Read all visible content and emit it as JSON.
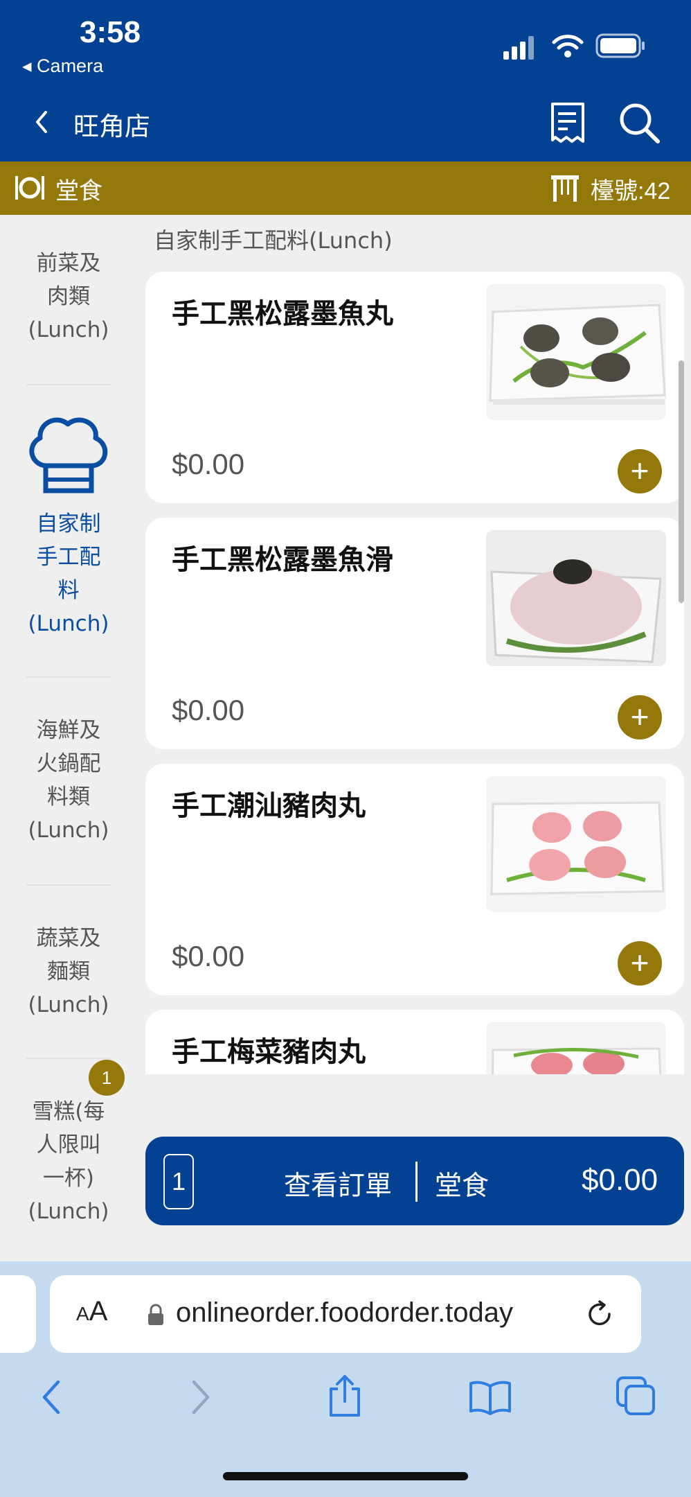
{
  "status_bar": {
    "time": "3:58",
    "back_app": "◂ Camera"
  },
  "header": {
    "store_name": "旺角店"
  },
  "mode_bar": {
    "mode": "堂食",
    "table": "檯號:42"
  },
  "sidebar": {
    "items": [
      {
        "lines": [
          "前菜及",
          "肉類",
          "(Lunch)"
        ]
      },
      {
        "lines": [
          "自家制",
          "手工配",
          "料",
          "(Lunch)"
        ],
        "active": true
      },
      {
        "lines": [
          "海鮮及",
          "火鍋配",
          "料類",
          "(Lunch)"
        ]
      },
      {
        "lines": [
          "蔬菜及",
          "麵類",
          "(Lunch)"
        ]
      },
      {
        "lines": [
          "雪糕(每",
          "人限叫",
          "一杯)",
          "(Lunch)"
        ],
        "badge": "1"
      }
    ]
  },
  "section": {
    "title": "自家制手工配料(Lunch)"
  },
  "menu_items": [
    {
      "name": "手工黑松露墨魚丸",
      "price": "$0.00"
    },
    {
      "name": "手工黑松露墨魚滑",
      "price": "$0.00"
    },
    {
      "name": "手工潮汕豬肉丸",
      "price": "$0.00"
    },
    {
      "name": "手工梅菜豬肉丸",
      "price": ""
    }
  ],
  "order_bar": {
    "count": "1",
    "view_order": "查看訂單",
    "mode": "堂食",
    "total": "$0.00"
  },
  "browser": {
    "aa_small": "A",
    "aa_large": "A",
    "url": "onlineorder.foodorder.today"
  },
  "colors": {
    "primary": "#034293",
    "accent": "#95780a",
    "background": "#efefef"
  }
}
